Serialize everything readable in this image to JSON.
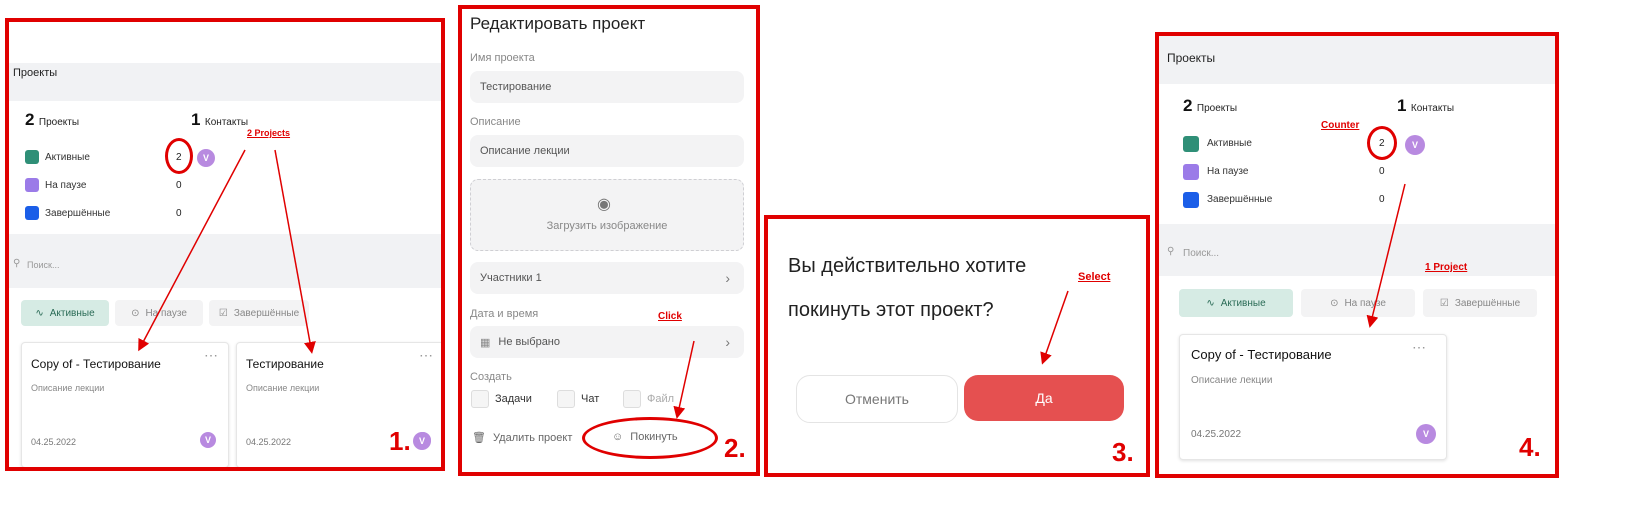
{
  "panel1": {
    "title": "Проекты",
    "projects_count": "2",
    "projects_label": "Проекты",
    "contacts_count": "1",
    "contacts_label": "Контакты",
    "statuses": [
      {
        "label": "Активные",
        "value": "2",
        "color": "#2f8f77"
      },
      {
        "label": "На паузе",
        "value": "0",
        "color": "#9b7be8"
      },
      {
        "label": "Завершённые",
        "value": "0",
        "color": "#1b5ee8"
      }
    ],
    "avatar_letter": "V",
    "search_placeholder": "Поиск...",
    "tabs": [
      "Активные",
      "На паузе",
      "Завершённые"
    ],
    "cards": [
      {
        "title": "Copy of - Тестирование",
        "desc": "Описание лекции",
        "date": "04.25.2022"
      },
      {
        "title": "Тестирование",
        "desc": "Описание лекции",
        "date": "04.25.2022"
      }
    ],
    "annotation": "2 Projects",
    "step": "1."
  },
  "panel2": {
    "title": "Редактировать проект",
    "name_label": "Имя проекта",
    "name_value": "Тестирование",
    "desc_label": "Описание",
    "desc_value": "Описание лекции",
    "upload_label": "Загрузить изображение",
    "participants": "Участники 1",
    "date_label": "Дата и время",
    "date_value": "Не выбрано",
    "create_label": "Создать",
    "checkboxes": [
      "Задачи",
      "Чат",
      "Файл"
    ],
    "delete_label": "Удалить проект",
    "leave_label": "Покинуть",
    "annotation": "Click",
    "step": "2."
  },
  "panel3": {
    "question_line1": "Вы действительно хотите",
    "question_line2": "покинуть этот проект?",
    "cancel_label": "Отменить",
    "confirm_label": "Да",
    "annotation": "Select",
    "step": "3."
  },
  "panel4": {
    "title": "Проекты",
    "projects_count": "2",
    "projects_label": "Проекты",
    "contacts_count": "1",
    "contacts_label": "Контакты",
    "statuses": [
      {
        "label": "Активные",
        "value": "2",
        "color": "#2f8f77"
      },
      {
        "label": "На паузе",
        "value": "0",
        "color": "#9b7be8"
      },
      {
        "label": "Завершённые",
        "value": "0",
        "color": "#1b5ee8"
      }
    ],
    "avatar_letter": "V",
    "search_placeholder": "Поиск...",
    "tabs": [
      "Активные",
      "На паузе",
      "Завершённые"
    ],
    "cards": [
      {
        "title": "Copy of - Тестирование",
        "desc": "Описание лекции",
        "date": "04.25.2022"
      }
    ],
    "annotation_counter": "Counter",
    "annotation_project": "1 Project",
    "step": "4."
  }
}
